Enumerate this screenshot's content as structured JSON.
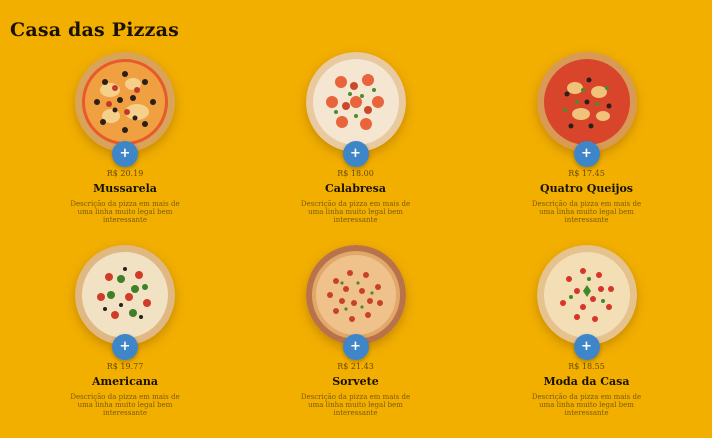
{
  "page": {
    "title": "Casa das Pizzas"
  },
  "colors": {
    "background": "#F2AF00",
    "button": "#3F86C8"
  },
  "pizzas": [
    {
      "price": "R$ 20.19",
      "name": "Mussarela",
      "description": "Descrição da pizza em mais de uma linha muito legal bem interessante",
      "add_label": "+",
      "icon": "pizza-icon"
    },
    {
      "price": "R$ 18.00",
      "name": "Calabresa",
      "description": "Descrição da pizza em mais de uma linha muito legal bem interessante",
      "add_label": "+",
      "icon": "pizza-icon"
    },
    {
      "price": "R$ 17.45",
      "name": "Quatro Queijos",
      "description": "Descrição da pizza em mais de uma linha muito legal bem interessante",
      "add_label": "+",
      "icon": "pizza-icon"
    },
    {
      "price": "R$ 19.77",
      "name": "Americana",
      "description": "Descrição da pizza em mais de uma linha muito legal bem interessante",
      "add_label": "+",
      "icon": "pizza-icon"
    },
    {
      "price": "R$ 21.43",
      "name": "Sorvete",
      "description": "Descrição da pizza em mais de uma linha muito legal bem interessante",
      "add_label": "+",
      "icon": "pizza-icon"
    },
    {
      "price": "R$ 18.55",
      "name": "Moda da Casa",
      "description": "Descrição da pizza em mais de uma linha muito legal bem interessante",
      "add_label": "+",
      "icon": "pizza-icon"
    }
  ]
}
